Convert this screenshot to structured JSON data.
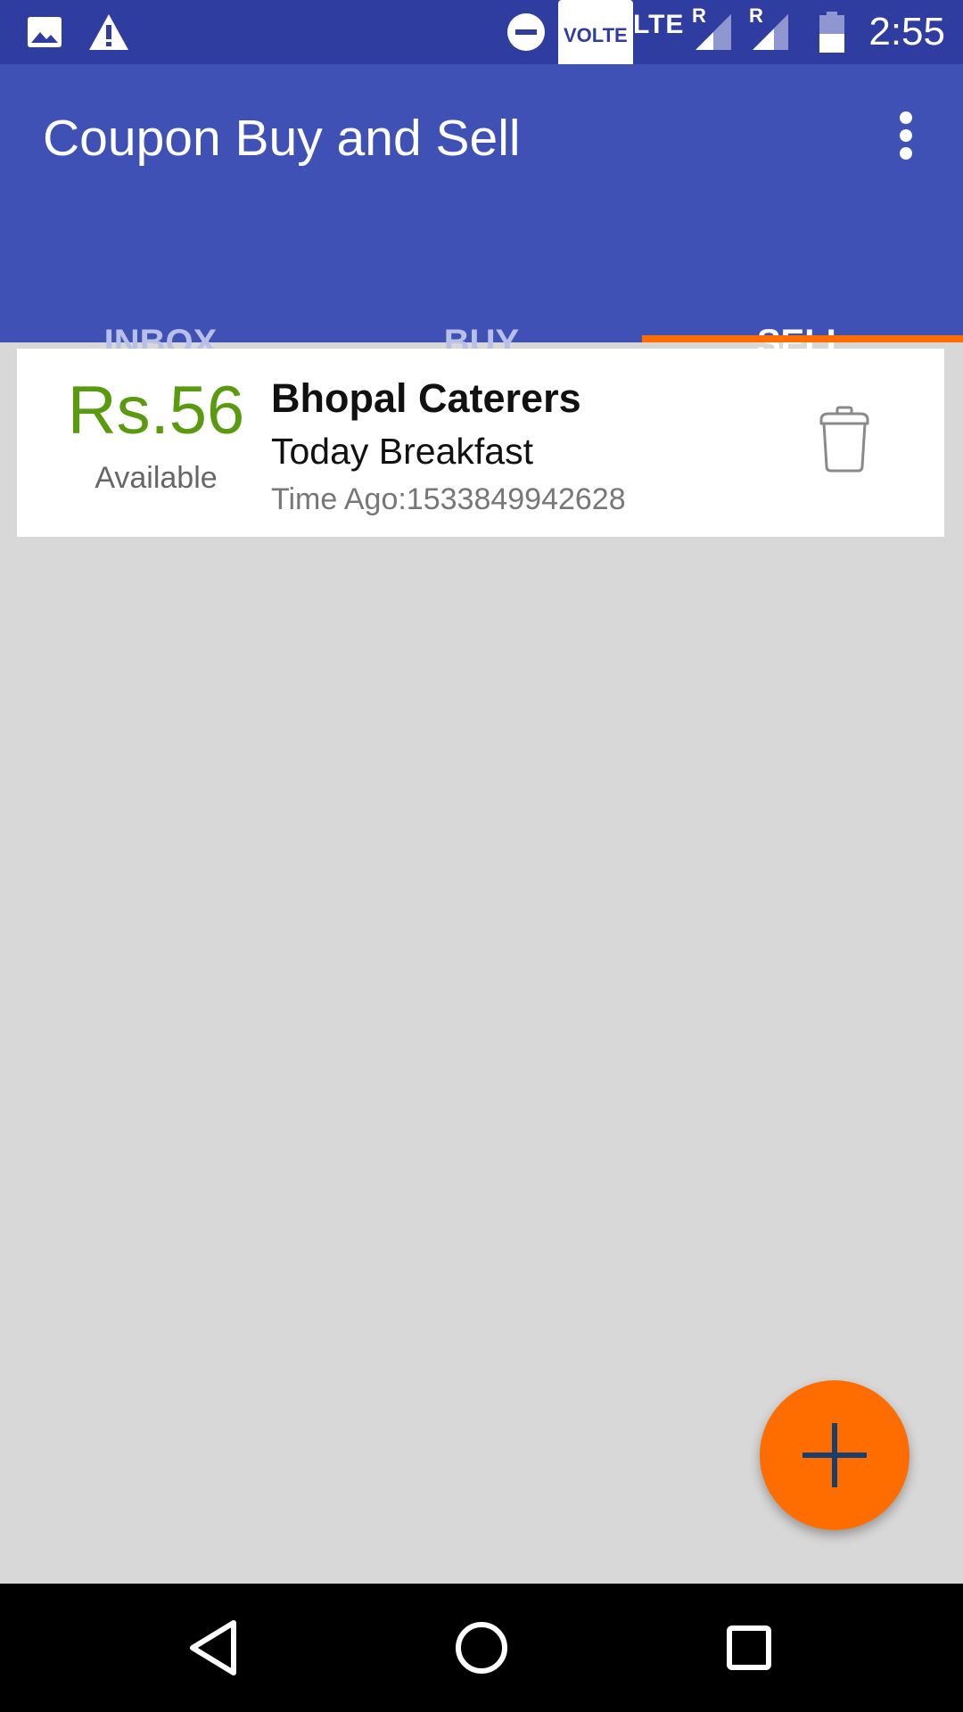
{
  "status_bar": {
    "time": "2:55",
    "network": "LTE",
    "volte": "VOLTE",
    "roaming_1": "R",
    "roaming_2": "R",
    "icons": [
      "image-icon",
      "warning-icon",
      "do-not-disturb-icon",
      "volte-badge",
      "signal-icon",
      "signal-icon",
      "battery-icon"
    ]
  },
  "app_bar": {
    "title": "Coupon Buy and Sell",
    "menu_icon": "overflow-menu-icon"
  },
  "tabs": [
    {
      "label": "INBOX",
      "active": false
    },
    {
      "label": "BUY",
      "active": false
    },
    {
      "label": "SELL",
      "active": true
    }
  ],
  "coupons": [
    {
      "price": "Rs.56",
      "status": "Available",
      "name": "Bhopal Caterers",
      "meal": "Today Breakfast",
      "time_ago": "Time Ago:1533849942628",
      "action_icon": "trash-icon"
    }
  ],
  "fab": {
    "icon": "plus-icon"
  },
  "colors": {
    "primary": "#3f51b5",
    "primary_dark": "#2f3da0",
    "accent": "#ff6d00",
    "price_green": "#5a9a0f",
    "background": "#d7d8d7"
  },
  "nav_bar": {
    "icons": [
      "back-icon",
      "home-icon",
      "recents-icon"
    ]
  }
}
